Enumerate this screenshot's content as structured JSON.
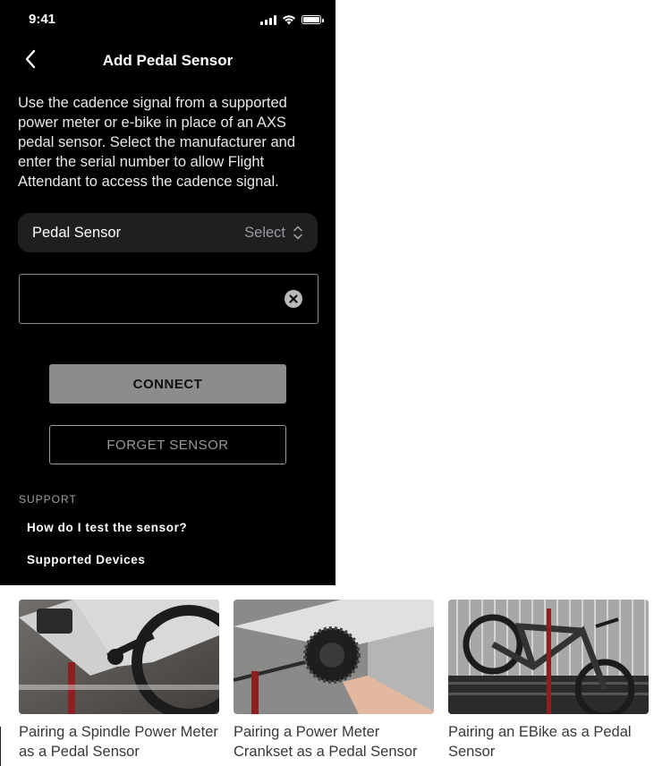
{
  "status_bar": {
    "time": "9:41",
    "signal_icon": "cellular-signal-icon",
    "wifi_icon": "wifi-icon",
    "battery_icon": "battery-icon"
  },
  "header": {
    "title": "Add Pedal Sensor",
    "back_icon": "chevron-left-icon"
  },
  "description": "Use the cadence signal from a supported power meter or e-bike in place of an AXS pedal sensor. Select the manufacturer and enter the serial number to allow Flight Attendant to access the cadence signal.",
  "sensor_selector": {
    "label": "Pedal Sensor",
    "value": "Select",
    "icon": "chevron-up-down-icon"
  },
  "serial_field": {
    "value": "",
    "placeholder": "",
    "clear_icon": "clear-icon"
  },
  "buttons": {
    "connect": "CONNECT",
    "forget": "FORGET SENSOR"
  },
  "support": {
    "heading": "SUPPORT",
    "links": [
      "How do I test the sensor?",
      "Supported Devices"
    ]
  },
  "videos": [
    {
      "caption": "Pairing a Spindle Power Meter as a Pedal Sensor"
    },
    {
      "caption": "Pairing a Power Meter Crankset as a Pedal Sensor"
    },
    {
      "caption": "Pairing an EBike as a Pedal Sensor"
    }
  ],
  "colors": {
    "background": "#000000",
    "field": "#1f1f21",
    "connect_button": "#8c8c8c",
    "muted_text": "#9a9a9e"
  }
}
